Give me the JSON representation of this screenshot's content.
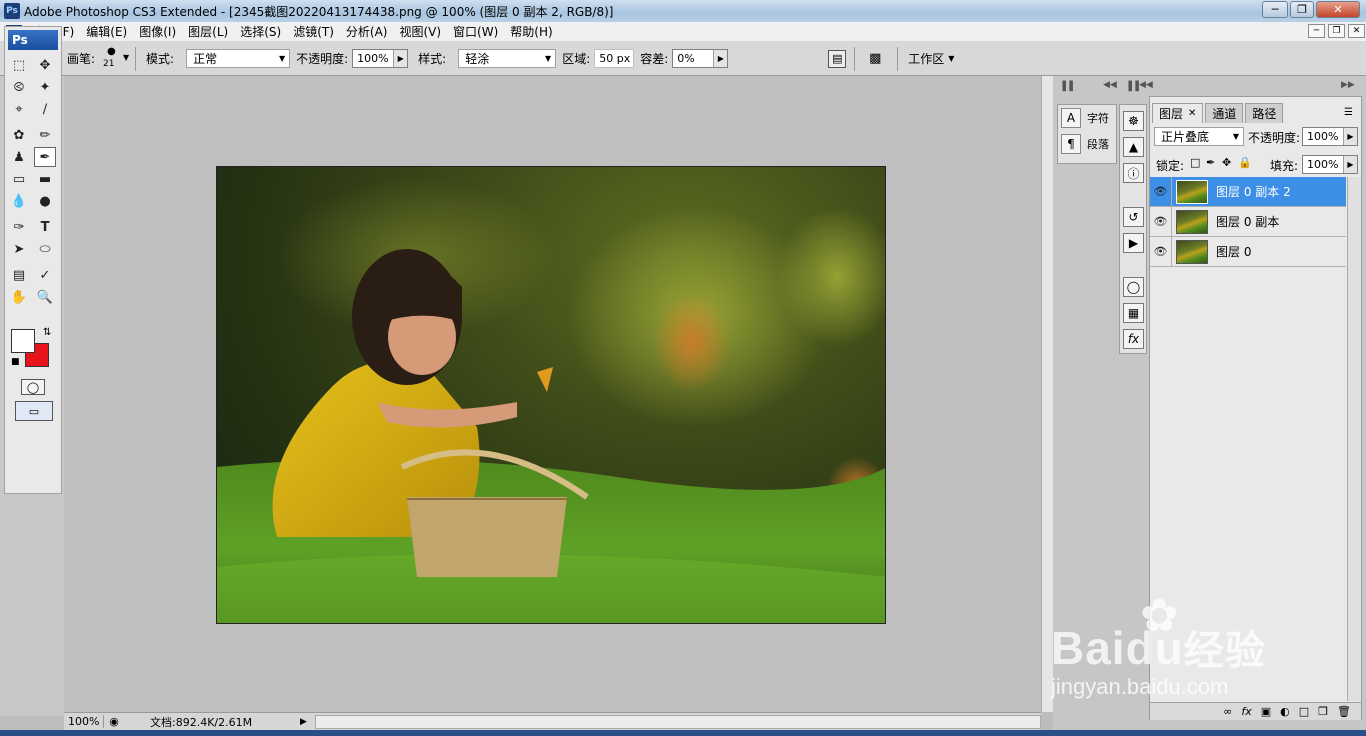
{
  "window": {
    "title": "Adobe Photoshop CS3 Extended - [2345截图20220413174438.png @ 100% (图层 0 副本 2, RGB/8)]",
    "app_icon": "Ps"
  },
  "menu": [
    "文件(F)",
    "编辑(E)",
    "图像(I)",
    "图层(L)",
    "选择(S)",
    "滤镜(T)",
    "分析(A)",
    "视图(V)",
    "窗口(W)",
    "帮助(H)"
  ],
  "options": {
    "brush_label": "画笔:",
    "brush_size": "21",
    "mode_label": "模式:",
    "mode_value": "正常",
    "opacity_label": "不透明度:",
    "opacity_value": "100%",
    "style_label": "样式:",
    "style_value": "轻涂",
    "area_label": "区域:",
    "area_value": "50 px",
    "tolerance_label": "容差:",
    "tolerance_value": "0%",
    "workspace_label": "工作区"
  },
  "toolbox": {
    "logo": "Ps"
  },
  "status": {
    "zoom": "100%",
    "doc_info": "文档:892.4K/2.61M"
  },
  "char_panel": {
    "char_label": "字符",
    "para_label": "段落"
  },
  "layers_panel": {
    "tabs": [
      "图层",
      "通道",
      "路径"
    ],
    "blend_mode": "正片叠底",
    "opacity_label": "不透明度:",
    "opacity_value": "100%",
    "lock_label": "锁定:",
    "fill_label": "填充:",
    "fill_value": "100%",
    "layers": [
      {
        "name": "图层 0 副本 2",
        "selected": true
      },
      {
        "name": "图层 0 副本",
        "selected": false
      },
      {
        "name": "图层 0",
        "selected": false
      }
    ]
  },
  "watermark": {
    "brand": "Baidu",
    "brand_cn": "经验",
    "site": "jingyan.baidu.com"
  },
  "colors": {
    "foreground": "#ffffff",
    "background": "#e8141c",
    "selection": "#3d8ee6"
  }
}
